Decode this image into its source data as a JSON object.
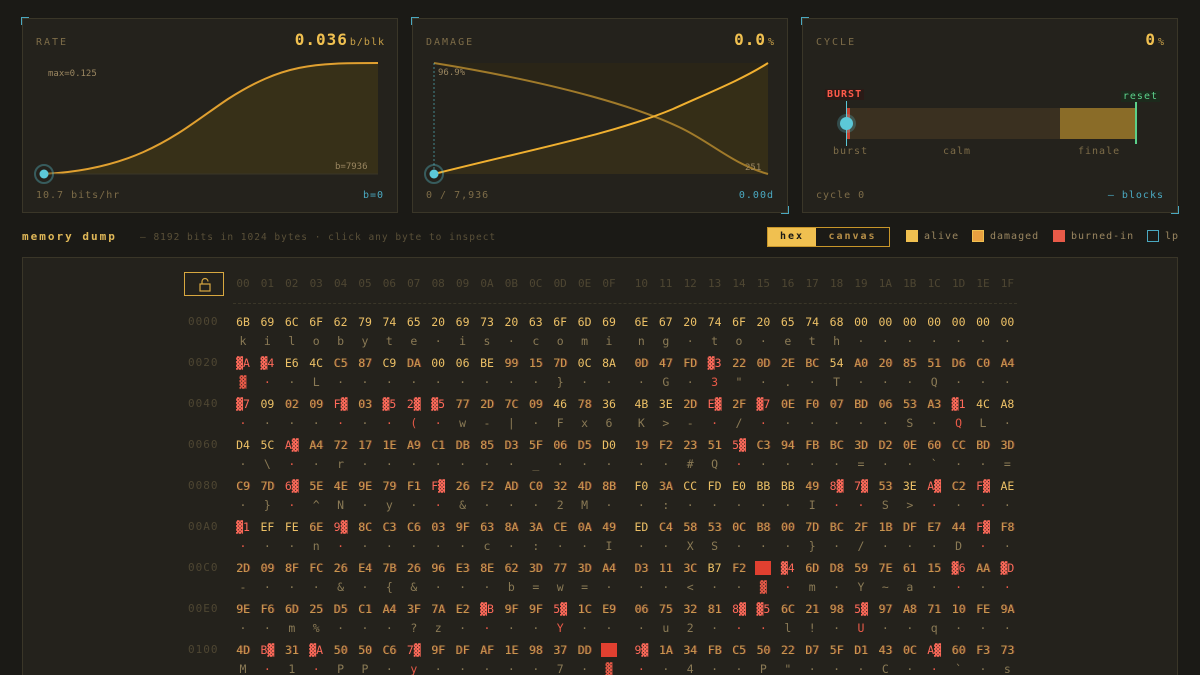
{
  "panels": {
    "rate": {
      "title": "RATE",
      "value": "0.036",
      "unit": "b/blk",
      "max_label": "max=0.125",
      "b_label": "b=7936",
      "foot_left": "10.7 bits/hr",
      "foot_right": "b=0"
    },
    "damage": {
      "title": "DAMAGE",
      "value": "0.0",
      "unit": "%",
      "top_label": "96.9%",
      "end_label": "251",
      "foot_left": "0 / 7,936",
      "foot_right": "0.00d"
    },
    "cycle": {
      "title": "CYCLE",
      "value": "0",
      "unit": "%",
      "burst_tag": "BURST",
      "reset_tag": "reset",
      "labels": [
        "burst",
        "calm",
        "finale"
      ],
      "foot_left": "cycle 0",
      "foot_right": "— blocks"
    }
  },
  "memory": {
    "title": "memory dump",
    "subtitle": "— 8192 bits in 1024 bytes · click any byte to inspect",
    "toggle": {
      "hex": "hex",
      "canvas": "canvas"
    },
    "legend": [
      {
        "label": "alive",
        "color": "#f0c050"
      },
      {
        "label": "damaged",
        "color": "#e8a040"
      },
      {
        "label": "burned-in",
        "color": "#e85a48"
      },
      {
        "label": "lp",
        "color": "#4aa8c0"
      }
    ],
    "col_headers": [
      "00",
      "01",
      "02",
      "03",
      "04",
      "05",
      "06",
      "07",
      "08",
      "09",
      "0A",
      "0B",
      "0C",
      "0D",
      "0E",
      "0F",
      "10",
      "11",
      "12",
      "13",
      "14",
      "15",
      "16",
      "17",
      "18",
      "19",
      "1A",
      "1B",
      "1C",
      "1D",
      "1E",
      "1F"
    ],
    "rows": [
      {
        "addr": "0000",
        "bytes": "6B 69 6C 6F 62 79 74 65 20 69 73 20 63 6F 6D 69 6E 67 20 74 6F 20 65 74 68 00 00 00 00 00 00 00",
        "ascii": "k i l o b y t e · i s · c o m i n g · t o · e t h · · · · · · ·",
        "damaged": [],
        "burned": []
      },
      {
        "addr": "0020",
        "bytes": "▓A ▓4 E6 4C C5 87 C9 DA 00 06 BE 99 15 7D 0C 8A 0D 47 FD ▓3 22 0D 2E BC 54 A0 20 85 51 D6 C0 A4",
        "ascii": "▓ · · L · · · · · · · · · } · · · G · 3 \" · . · T · · · Q · · ·",
        "damaged": [
          4,
          5,
          7,
          11,
          12,
          13,
          16,
          17,
          18,
          20,
          21,
          22,
          23,
          25,
          26,
          27,
          28,
          29,
          30,
          31
        ],
        "burned": [
          0,
          1,
          19
        ]
      },
      {
        "addr": "0040",
        "bytes": "▓7 09 02 09 F▓ 03 ▓5 2▓ ▓5 77 2D 7C 09 46 78 36 4B 3E 2D E▓ 2F ▓7 0E F0 07 BD 06 53 A3 ▓1 4C A8",
        "ascii": "· · · · · · · ( · w - | · F x 6 K > - · / · · · · · · S · Q L ·",
        "damaged": [
          2,
          3,
          5,
          9,
          10,
          11,
          12,
          14,
          18,
          20,
          22,
          23,
          24,
          25,
          26,
          27,
          28
        ],
        "burned": [
          0,
          4,
          6,
          7,
          8,
          19,
          21,
          29
        ]
      },
      {
        "addr": "0060",
        "bytes": "D4 5C A▓ A4 72 17 1E A9 C1 DB 85 D3 5F 06 D5 D0 19 F2 23 51 5▓ C3 94 FB BC 3D D2 0E 60 CC BD 3D",
        "ascii": "· \\ · · r · · · · · · · _ · · · · · # Q · · · · · = · · ` · · =",
        "damaged": [
          3,
          4,
          5,
          6,
          7,
          8,
          9,
          10,
          11,
          12,
          13,
          14,
          16,
          17,
          18,
          19,
          21,
          22,
          23,
          24,
          25,
          26,
          27,
          28,
          29,
          30,
          31
        ],
        "burned": [
          2,
          20
        ]
      },
      {
        "addr": "0080",
        "bytes": "C9 7D 6▓ 5E 4E 9E 79 F1 F▓ 26 F2 AD C0 32 4D 8B F0 3A CC FD E0 BB BB 49 8▓ 7▓ 53 3E A▓ C2 F▓ AE",
        "ascii": "· } · ^ N · y · · & · · · 2 M · · : · · · · · I · · S > · · · ·",
        "damaged": [
          0,
          1,
          3,
          4,
          5,
          6,
          7,
          9,
          10,
          11,
          12,
          13,
          14,
          15,
          17,
          23,
          26,
          29
        ],
        "burned": [
          2,
          8,
          24,
          25,
          28,
          30
        ]
      },
      {
        "addr": "00A0",
        "bytes": "▓1 EF FE 6E 9▓ 8C C3 C6 03 9F 63 8A 3A CE 0A 49 ED C4 58 53 0C B8 00 7D BC 2F 1B DF E7 44 F▓ F8",
        "ascii": "· · · n · · · · · · c · : · · I · · X S · · · } · / · · · D · ·",
        "damaged": [
          3,
          5,
          6,
          7,
          8,
          9,
          10,
          11,
          12,
          13,
          14,
          15,
          17,
          18,
          19,
          20,
          21,
          22,
          23,
          24,
          25,
          26,
          27,
          28,
          29,
          31
        ],
        "burned": [
          0,
          4,
          30
        ]
      },
      {
        "addr": "00C0",
        "bytes": "2D 09 8F FC 26 E4 7B 26 96 E3 8E 62 3D 77 3D A4 D3 11 3C B7 F2 ▓▓ ▓4 6D D8 59 7E 61 15 ▓6 AA ▓D",
        "ascii": "- · · · & · { & · · · b = w = · · · < · · ▓ · m · Y ~ a · · · ·",
        "damaged": [
          0,
          1,
          2,
          3,
          4,
          5,
          6,
          7,
          8,
          9,
          10,
          11,
          12,
          13,
          14,
          15,
          16,
          17,
          18,
          20,
          23,
          24,
          25,
          26,
          27,
          28,
          30
        ],
        "burned": [
          21,
          22,
          29,
          31
        ]
      },
      {
        "addr": "00E0",
        "bytes": "9E F6 6D 25 D5 C1 A4 3F 7A E2 ▓B 9F 9F 5▓ 1C E9 06 75 32 81 8▓ ▓5 6C 21 98 5▓ 97 A8 71 10 FE 9A",
        "ascii": "· · m % · · · ? z · · · · Y · · · u 2 · · · l ! · U · · q · · ·",
        "damaged": [
          0,
          1,
          2,
          3,
          4,
          5,
          6,
          7,
          8,
          9,
          11,
          12,
          14,
          15,
          16,
          17,
          18,
          19,
          22,
          23,
          24,
          26,
          27,
          28,
          29,
          30,
          31
        ],
        "burned": [
          10,
          13,
          20,
          21,
          25
        ]
      },
      {
        "addr": "0100",
        "bytes": "4D B▓ 31 ▓A 50 50 C6 7▓ 9F DF AF 1E 98 37 DD ▓▓ 9▓ 1A 34 FB C5 50 22 D7 5F D1 43 0C A▓ 60 F3 73",
        "ascii": "M · 1 · P P · y · · · · · 7 · ▓ · · 4 · · P \" · · · C · · ` · s",
        "damaged": [
          0,
          2,
          4,
          5,
          6,
          8,
          9,
          10,
          11,
          12,
          13,
          14,
          17,
          18,
          19,
          20,
          21,
          22,
          23,
          24,
          25,
          26,
          27,
          29,
          30,
          31
        ],
        "burned": [
          1,
          3,
          7,
          15,
          16,
          28
        ]
      }
    ]
  }
}
